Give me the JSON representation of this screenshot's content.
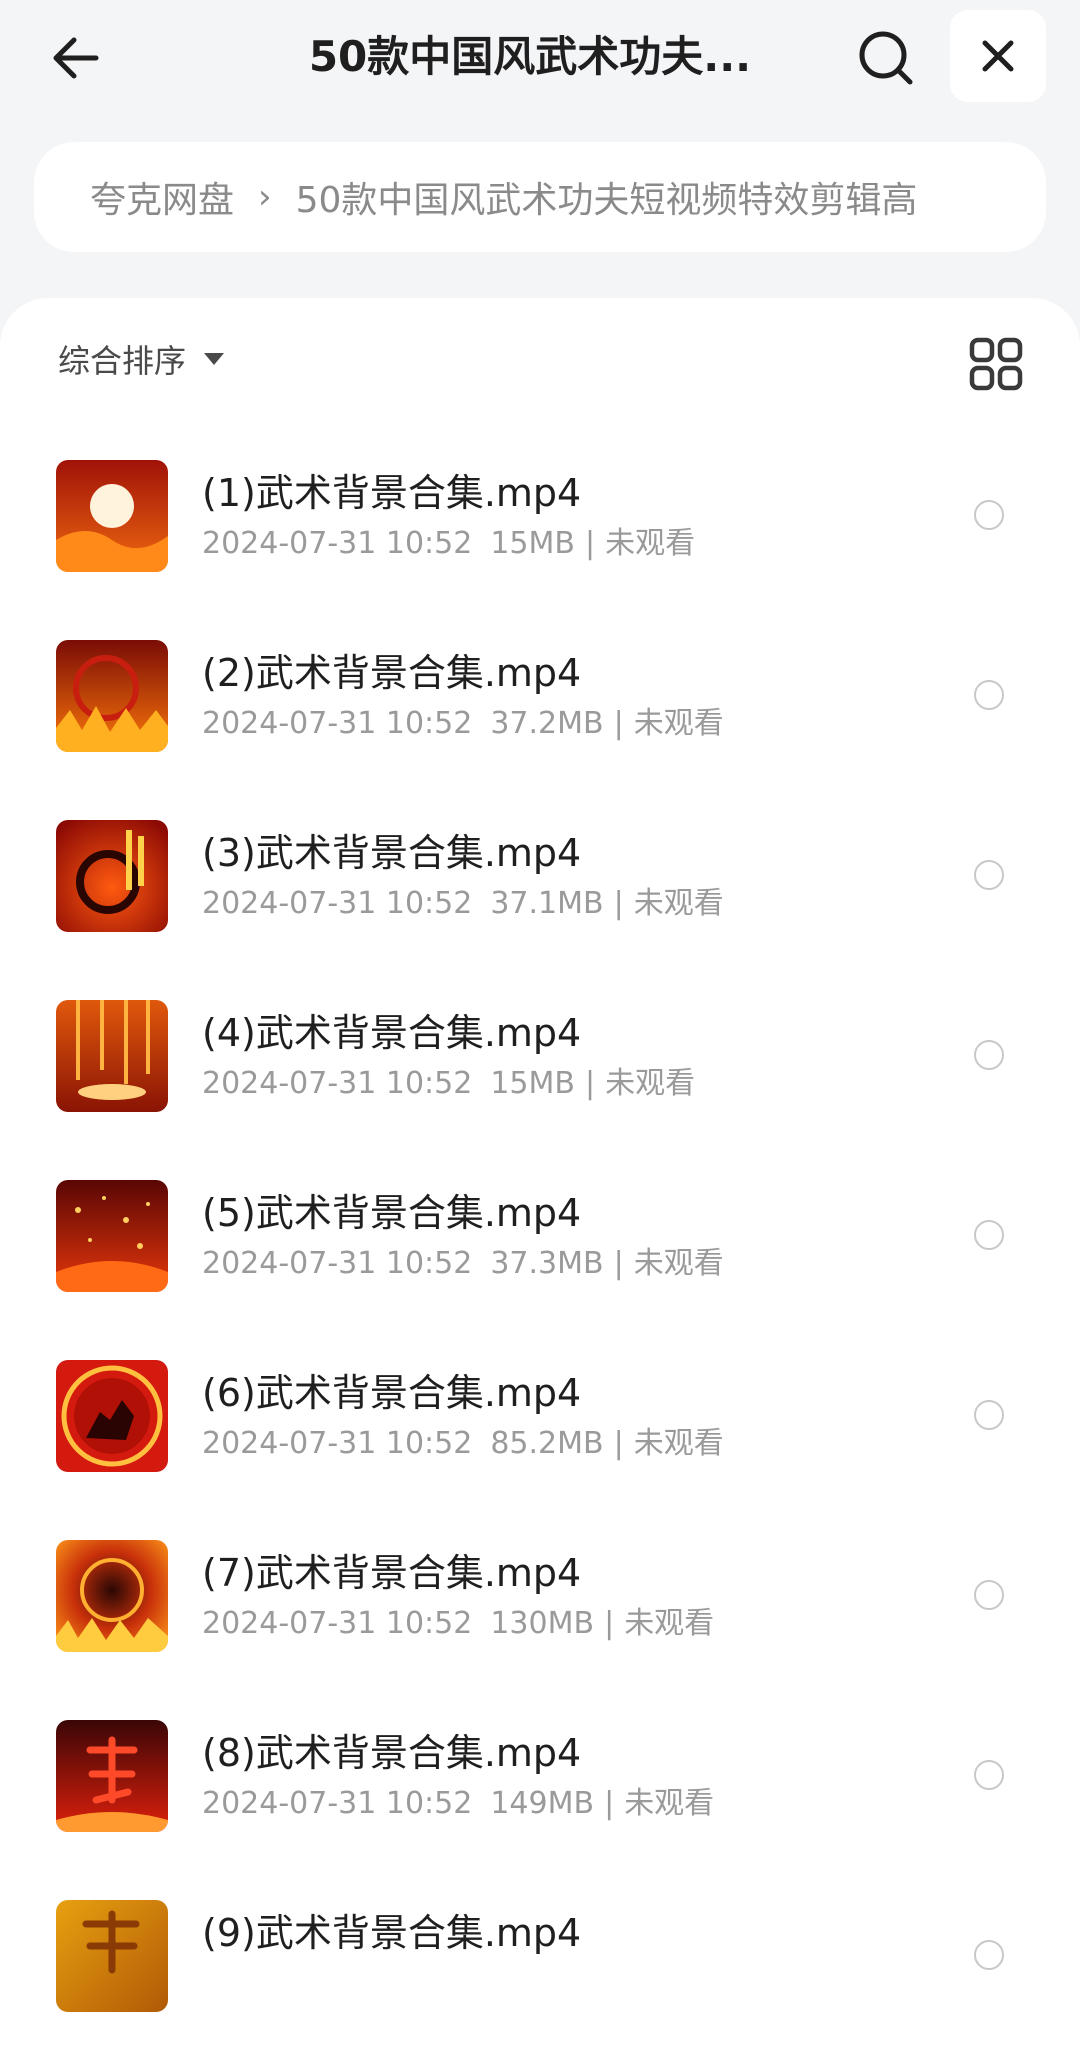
{
  "header": {
    "title": "50款中国风武术功夫...",
    "back_icon": "arrow-left-icon",
    "search_icon": "search-icon",
    "close_icon": "close-icon"
  },
  "breadcrumb": {
    "root": "夸克网盘",
    "separator": "›",
    "current": "50款中国风武术功夫短视频特效剪辑高"
  },
  "toolbar": {
    "sort_label": "综合排序",
    "view_icon": "grid-view-icon"
  },
  "files": [
    {
      "name": "(1)武术背景合集.mp4",
      "date": "2024-07-31 10:52",
      "size": "15MB",
      "status": "未观看"
    },
    {
      "name": "(2)武术背景合集.mp4",
      "date": "2024-07-31 10:52",
      "size": "37.2MB",
      "status": "未观看"
    },
    {
      "name": "(3)武术背景合集.mp4",
      "date": "2024-07-31 10:52",
      "size": "37.1MB",
      "status": "未观看"
    },
    {
      "name": "(4)武术背景合集.mp4",
      "date": "2024-07-31 10:52",
      "size": "15MB",
      "status": "未观看"
    },
    {
      "name": "(5)武术背景合集.mp4",
      "date": "2024-07-31 10:52",
      "size": "37.3MB",
      "status": "未观看"
    },
    {
      "name": "(6)武术背景合集.mp4",
      "date": "2024-07-31 10:52",
      "size": "85.2MB",
      "status": "未观看"
    },
    {
      "name": "(7)武术背景合集.mp4",
      "date": "2024-07-31 10:52",
      "size": "130MB",
      "status": "未观看"
    },
    {
      "name": "(8)武术背景合集.mp4",
      "date": "2024-07-31 10:52",
      "size": "149MB",
      "status": "未观看"
    },
    {
      "name": "(9)武术背景合集.mp4",
      "date": "",
      "size": "",
      "status": ""
    }
  ],
  "colors": {
    "background": "#f4f5f7",
    "panel": "#ffffff",
    "meta_text": "#9a9a9a",
    "breadcrumb_text": "#8a8a8a"
  }
}
